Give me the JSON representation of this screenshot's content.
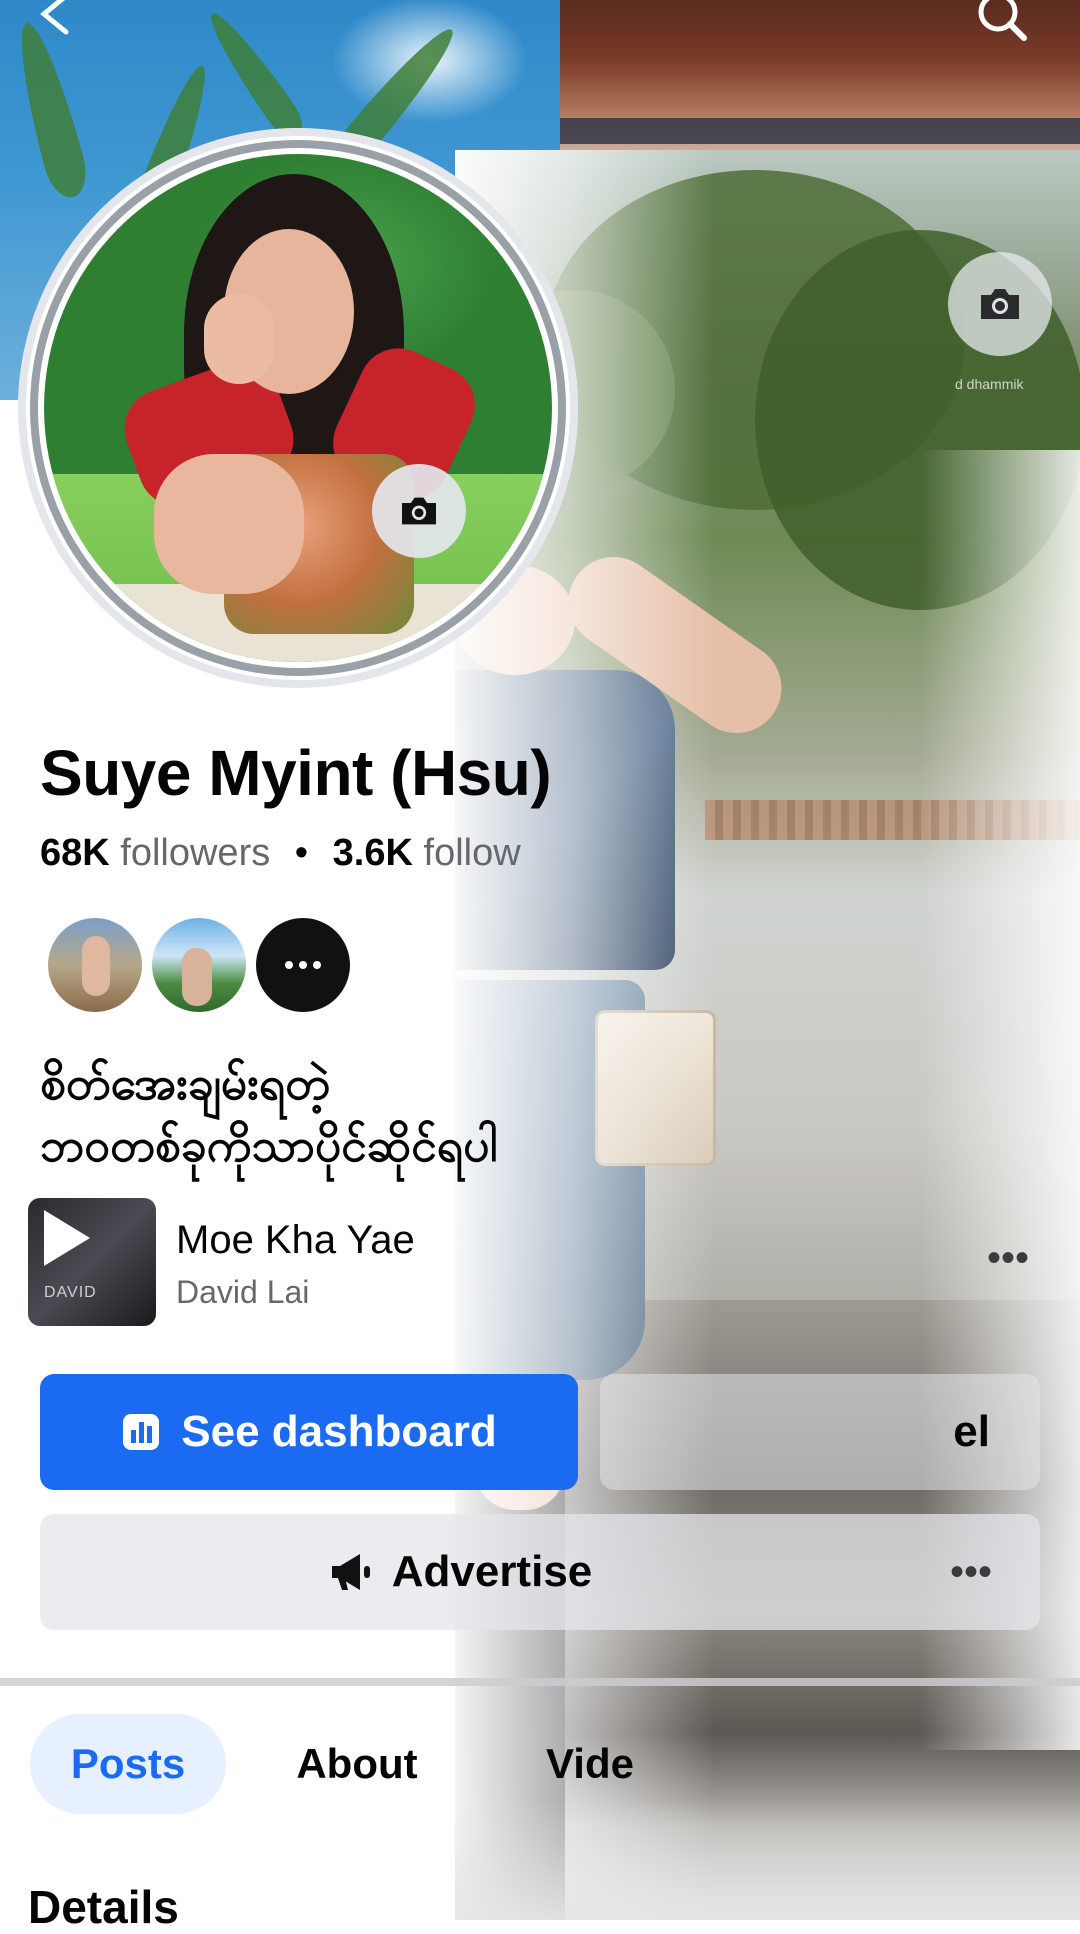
{
  "profile": {
    "name": "Suye Myint (Hsu)",
    "followers_count": "68K",
    "followers_label": "followers",
    "following_count": "3.6K",
    "following_label": "follow",
    "bio": "စိတ်အေးချမ်းရတဲ့\nဘဝတစ်ခုကိုသာပိုင်ဆိုင်ရပါ"
  },
  "music": {
    "title": "Moe Kha Yae",
    "artist": "David Lai",
    "art_text": "DAVID"
  },
  "buttons": {
    "dashboard_label": "See dashboard",
    "edit_label_partial": "el",
    "advertise_label": "Advertise",
    "more_label": "•••"
  },
  "tabs": [
    {
      "label": "Posts",
      "selected": true
    },
    {
      "label": "About",
      "selected": false
    },
    {
      "label": "Vide",
      "selected": false
    }
  ],
  "section_heading": "Details",
  "cover_credit": "d dhammik",
  "icons": {
    "back": "back-arrow-icon",
    "search": "search-icon",
    "cover_camera": "camera-icon",
    "avatar_camera": "camera-icon",
    "dashboard": "bar-chart-icon",
    "advertise": "megaphone-icon",
    "more": "more-dots-icon"
  },
  "colors": {
    "primary": "#1b6bf2",
    "tab_selected_bg": "#e7f0fe",
    "secondary_text": "#65676b",
    "button_gray": "#e4e6eb"
  }
}
